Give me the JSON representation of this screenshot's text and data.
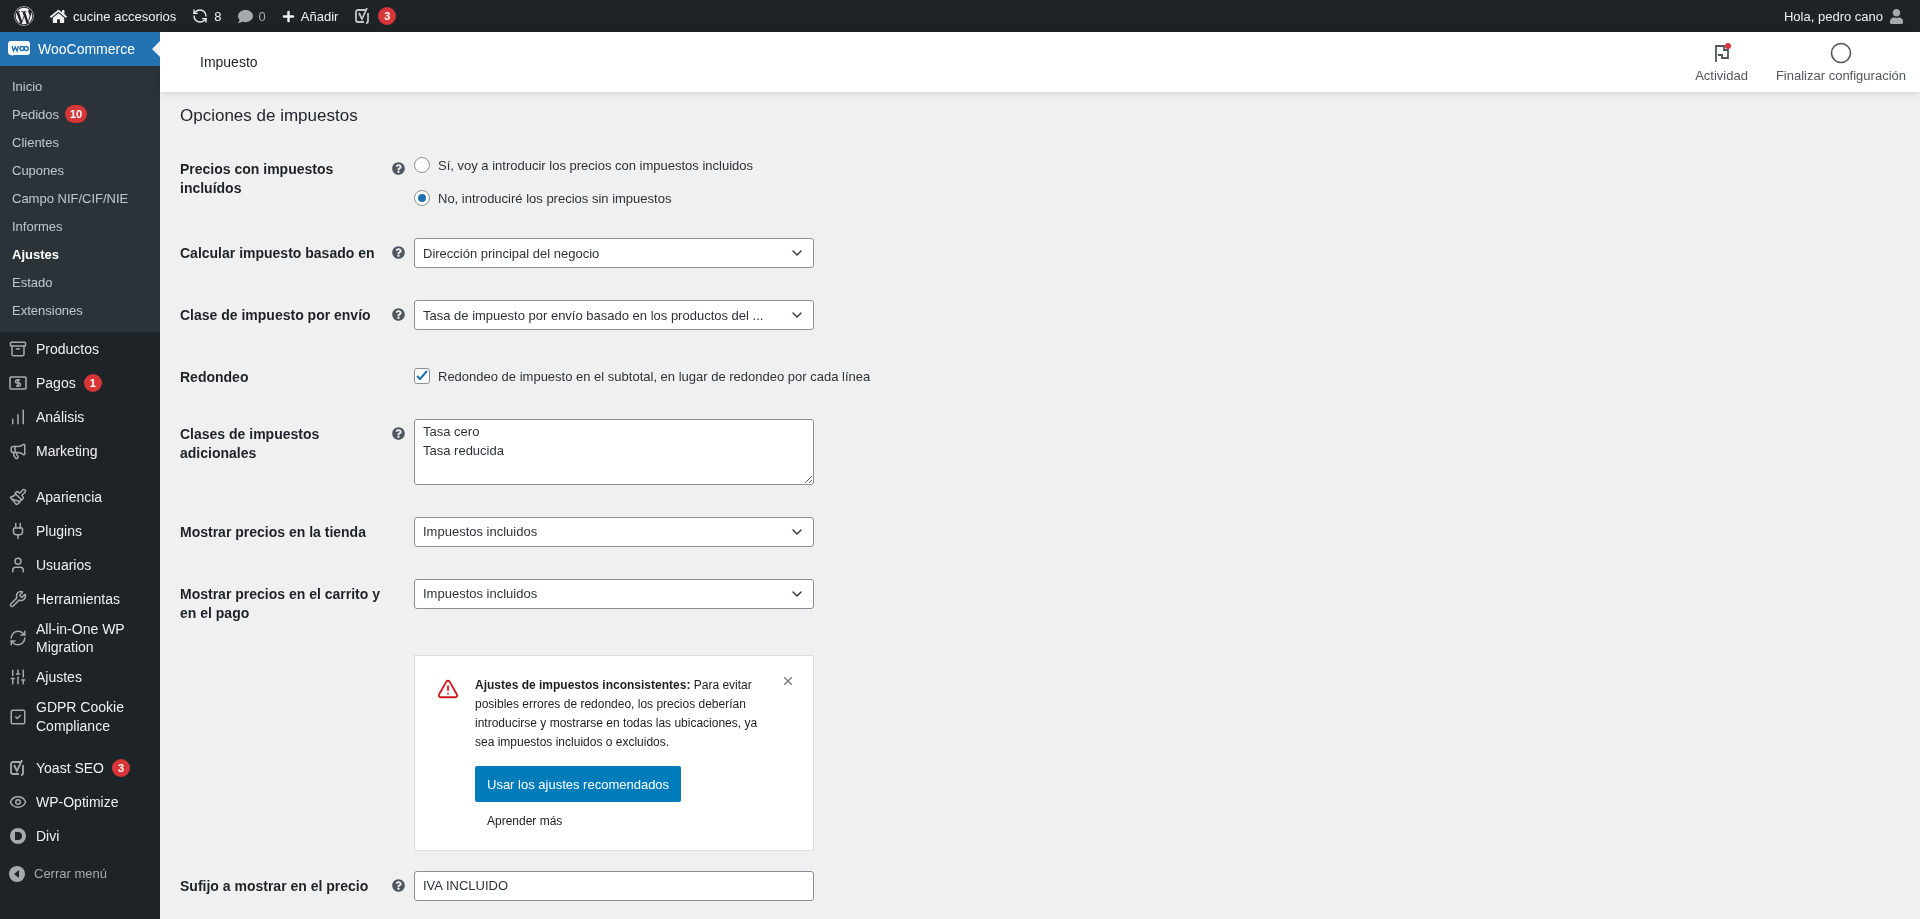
{
  "admin_bar": {
    "site_name": "cucine accesorios",
    "updates": "8",
    "comments": "0",
    "add_label": "Añadir",
    "seo_badge": "3",
    "greeting": "Hola, pedro cano"
  },
  "sidebar": {
    "woocommerce": {
      "label": "WooCommerce",
      "selected": true
    },
    "submenu": [
      {
        "label": "Inicio",
        "selected": false
      },
      {
        "label": "Pedidos",
        "selected": false,
        "badge": "10"
      },
      {
        "label": "Clientes",
        "selected": false
      },
      {
        "label": "Cupones",
        "selected": false
      },
      {
        "label": "Campo NIF/CIF/NIE",
        "selected": false
      },
      {
        "label": "Informes",
        "selected": false
      },
      {
        "label": "Ajustes",
        "selected": true
      },
      {
        "label": "Estado",
        "selected": false
      },
      {
        "label": "Extensiones",
        "selected": false
      }
    ],
    "menu_groups": [
      [
        {
          "label": "Productos",
          "selected": false
        },
        {
          "label": "Pagos",
          "selected": false,
          "badge": "1"
        },
        {
          "label": "Análisis",
          "selected": false
        },
        {
          "label": "Marketing",
          "selected": false
        }
      ],
      [
        {
          "label": "Apariencia",
          "selected": false
        },
        {
          "label": "Plugins",
          "selected": false
        },
        {
          "label": "Usuarios",
          "selected": false
        },
        {
          "label": "Herramientas",
          "selected": false
        },
        {
          "label": "All-in-One WP Migration",
          "selected": false
        },
        {
          "label": "Ajustes",
          "selected": false
        },
        {
          "label": "GDPR Cookie Compliance",
          "selected": false
        }
      ],
      [
        {
          "label": "Yoast SEO",
          "selected": false,
          "badge": "3"
        },
        {
          "label": "WP-Optimize",
          "selected": false
        },
        {
          "label": "Divi",
          "selected": false
        }
      ]
    ],
    "collapse_label": "Cerrar menú"
  },
  "header": {
    "title": "Impuesto",
    "actions": [
      {
        "label": "Actividad",
        "has_notification": true
      },
      {
        "label": "Finalizar configuración",
        "has_notification": false
      }
    ]
  },
  "section_title": "Opciones de impuestos",
  "fields": [
    {
      "kind": "radio",
      "label": "Precios con impuestos incluídos",
      "help": true,
      "options": [
        {
          "label": "Sí, voy a introducir los precios con impuestos incluidos",
          "selected": false
        },
        {
          "label": "No, introduciré los precios sin impuestos",
          "selected": true
        }
      ]
    },
    {
      "kind": "select",
      "label": "Calcular impuesto basado en",
      "help": true,
      "value": "Dirección principal del negocio"
    },
    {
      "kind": "select",
      "label": "Clase de impuesto por envío",
      "help": true,
      "value": "Tasa de impuesto por envío basado en los productos del ..."
    },
    {
      "kind": "checkbox",
      "label": "Redondeo",
      "text": "Redondeo de impuesto en el subtotal, en lugar de redondeo por cada línea",
      "checked": true
    },
    {
      "kind": "textarea",
      "label": "Clases de impuestos adicionales",
      "help": true,
      "value": "Tasa cero\nTasa reducida"
    },
    {
      "kind": "select",
      "label": "Mostrar precios en la tienda",
      "value": "Impuestos incluidos"
    },
    {
      "kind": "select",
      "label": "Mostrar precios en el carrito y en el pago",
      "value": "Impuestos incluidos"
    },
    {
      "kind": "notice",
      "text": "**Ajustes de impuestos inconsistentes:** Para evitar posibles errores de redondeo, los precios deberían introducirse y mostrarse en todas las ubicaciones, ya sea impuestos incluidos o excluidos.",
      "button": "Usar los ajustes recomendados",
      "link": "Aprender más"
    },
    {
      "kind": "text",
      "label": "Sufijo a mostrar en el precio",
      "help": true,
      "value": "IVA INCLUIDO"
    }
  ]
}
